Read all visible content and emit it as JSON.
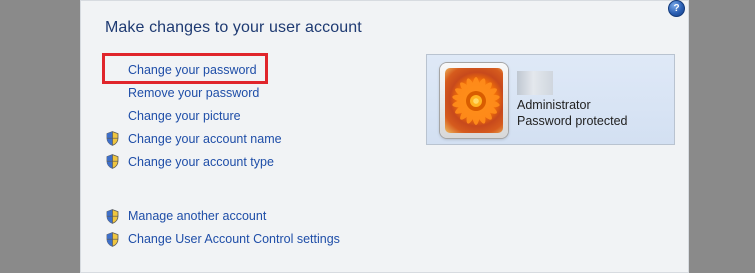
{
  "page": {
    "title": "Make changes to your user account",
    "help_icon": "?"
  },
  "tasks": [
    {
      "label": "Change your password",
      "icon": "none"
    },
    {
      "label": "Remove your password",
      "icon": "none"
    },
    {
      "label": "Change your picture",
      "icon": "none"
    },
    {
      "label": "Change your account name",
      "icon": "shield-icon"
    },
    {
      "label": "Change your account type",
      "icon": "shield-icon"
    },
    {
      "label": "Manage another account",
      "icon": "shield-icon"
    },
    {
      "label": "Change User Account Control settings",
      "icon": "shield-icon"
    }
  ],
  "account": {
    "name": "Administrator",
    "status": "Password protected"
  },
  "colors": {
    "link": "#1f4ea8",
    "title": "#1e3a72",
    "highlight": "#e0252b"
  }
}
